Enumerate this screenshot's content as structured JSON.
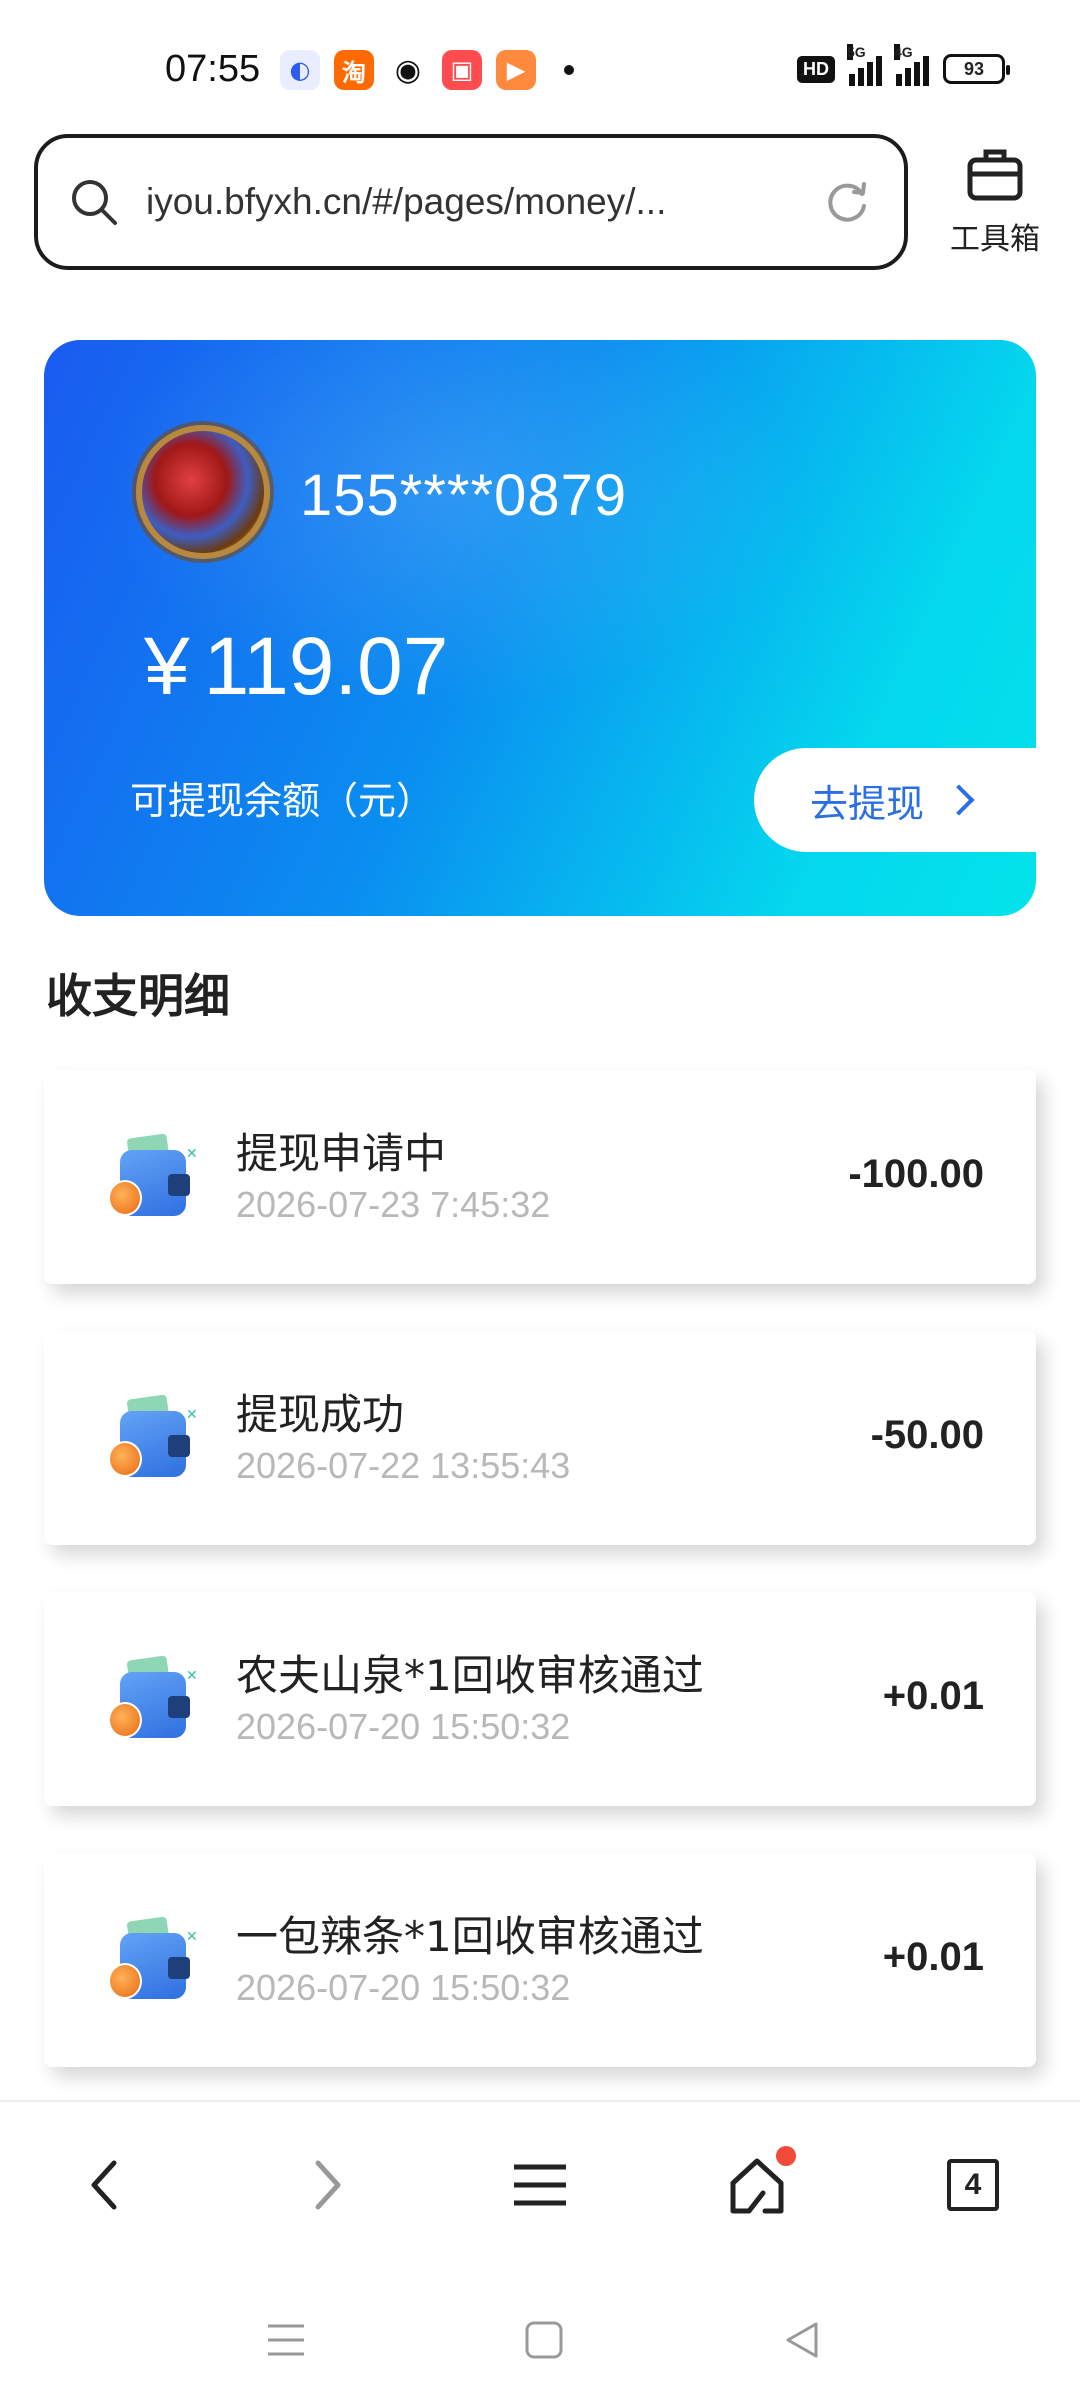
{
  "status_bar": {
    "time": "07:55",
    "notification_apps": [
      {
        "name": "baidu-app-icon",
        "glyph": "◐",
        "color": "#f0f2ff"
      },
      {
        "name": "taobao-app-icon",
        "glyph": "淘",
        "color": "#ff6a00"
      },
      {
        "name": "wechat-app-icon",
        "glyph": "◉",
        "color": "#ffffff"
      },
      {
        "name": "pinduoduo-app-icon",
        "glyph": "▣",
        "color": "#ff4d4f"
      },
      {
        "name": "video-app-icon",
        "glyph": "▶",
        "color": "#ff8a3d"
      }
    ],
    "hd_label": "HD",
    "network_1": "5G",
    "network_2": "4G",
    "battery": "93"
  },
  "browser": {
    "url": "iyou.bfyxh.cn/#/pages/money/...",
    "toolbox_label": "工具箱",
    "tabs_count": "4"
  },
  "balance_card": {
    "phone": "155****0879",
    "currency_symbol": "¥",
    "amount": "119.07",
    "label": "可提现余额（元）",
    "withdraw_label": "去提现"
  },
  "section_title": "收支明细",
  "records": [
    {
      "title": "提现申请中",
      "time": "2026-07-23 7:45:32",
      "amount": "-100.00"
    },
    {
      "title": "提现成功",
      "time": "2026-07-22 13:55:43",
      "amount": "-50.00"
    },
    {
      "title": "农夫山泉*1回收审核通过",
      "time": "2026-07-20 15:50:32",
      "amount": "+0.01"
    },
    {
      "title": "一包辣条*1回收审核通过",
      "time": "2026-07-20 15:50:32",
      "amount": "+0.01"
    }
  ],
  "colors": {
    "accent": "#2a6fe4",
    "card_gradient_start": "#1a5bf0",
    "card_gradient_end": "#03e3ea",
    "notification_dot": "#f04a3a"
  }
}
